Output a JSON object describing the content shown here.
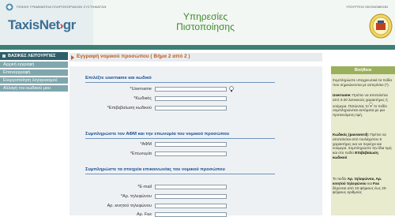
{
  "header": {
    "ministry_caption": "ΓΕΝΙΚΗ ΓΡΑΜΜΑΤΕΙΑ ΠΛΗΡΟΦΟΡΙΑΚΩΝ ΣΥΣΤΗΜΑΤΩΝ",
    "logo_text": "TaxisNet",
    "logo_suffix": "gr",
    "service_line1": "Υπηρεσίες",
    "service_line2": "Πιστοποίησης",
    "right_caption": "ΥΠΟΥΡΓΕΙΟ ΟΙΚΟΝΟΜΙΚΩΝ"
  },
  "sidebar": {
    "header": "ΒΑΣΙΚΕΣ ΛΕΙΤΟΥΡΓΙΕΣ",
    "items": [
      {
        "label": "Αρχική εγγραφή"
      },
      {
        "label": "Επανεγγραφή"
      },
      {
        "label": "Ενεργοποίηση λογαριασμού"
      },
      {
        "label": "Αλλαγή του κωδικού μου"
      }
    ]
  },
  "main": {
    "title": "Εγγραφή νομικού προσώπου ( Βήμα 2 από 2 )",
    "sections": [
      {
        "title": "Επιλέξτε username και κωδικό",
        "fields": [
          {
            "label": "*Username",
            "value": ""
          },
          {
            "label": "*Κωδικός",
            "value": ""
          },
          {
            "label": "*Επιβεβαίωση κωδικού",
            "value": ""
          }
        ]
      },
      {
        "title": "Συμπληρώστε τον ΑΦΜ και την επωνυμία του νομικού προσώπου",
        "fields": [
          {
            "label": "*ΑΦΜ",
            "value": ""
          },
          {
            "label": "*Επωνυμία",
            "value": ""
          }
        ]
      },
      {
        "title": "Συμπληρώστε τα στοιχεία επικοινωνίας του νομικού προσώπου",
        "fields": [
          {
            "label": "*E-mail",
            "value": ""
          },
          {
            "label": "*Αρ. τηλεφώνου",
            "value": ""
          },
          {
            "label": "Αρ. κινητού τηλεφώνου",
            "value": ""
          },
          {
            "label": "Αρ. Fax",
            "value": ""
          }
        ]
      }
    ]
  },
  "help": {
    "title": "Βοήθεια",
    "p1": "Συμπληρώστε υποχρεωτικά τα πεδία που σημειώνονται με αστερίσκο (*).",
    "p2_bold": "Username:",
    "p2": " Πρέπει να αποτελείται από 3-20 λατινικούς χαρακτήρες ή νούμερα. Πατώντας το",
    "p2b": " το πεδίο συμπληρώνεται αυτόματα με μια προτεινόμενη τιμή.",
    "p3_bold": "Κωδικός (password):",
    "p3": " Πρέπει να αποτελείται από τουλάχιστον 5 χαρακτήρες και να περιέχει και νούμερα. Συμπληρώστε την ίδια τιμή και στο πεδίο ",
    "p3_bold2": "Επιβεβαίωση κωδικού",
    "p4": "Το πεδίο ",
    "p4_bold": "Αρ. τηλεφώνου, Αρ. κινητού τηλεφώνου",
    "p4b": " και ",
    "p4_bold2": "Fax",
    "p4c": " δέχονται από 10-ψήφιους έως 20-ψήφιους αριθμούς"
  },
  "colors": {
    "band": "#3d7f75",
    "sidebar_header": "#2e5f6b",
    "sidebar_item": "#7fa7ae",
    "title": "#c25a1e",
    "section_title": "#1a4f91",
    "help_head": "#9bb05c"
  }
}
